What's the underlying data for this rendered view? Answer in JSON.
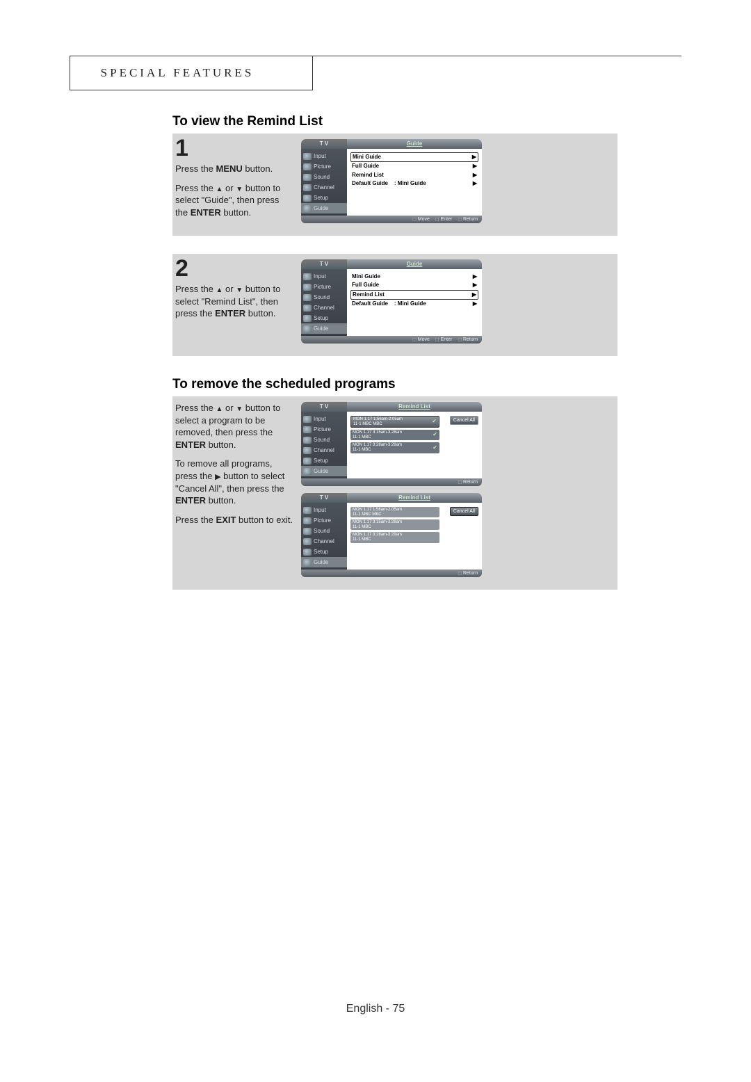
{
  "header": "SPECIAL FEATURES",
  "section1_title": "To view the Remind List",
  "step1": {
    "num": "1",
    "p1_a": "Press the ",
    "p1_b": "MENU",
    "p1_c": " button.",
    "p2_a": "Press the ",
    "p2_b": " or ",
    "p2_c": " button to select \"Guide\", then press the ",
    "p2_d": "ENTER",
    "p2_e": " button."
  },
  "step2": {
    "num": "2",
    "p1_a": "Press the ",
    "p1_b": " or ",
    "p1_c": " button to select \"Remind List\", then press the ",
    "p1_d": "ENTER",
    "p1_e": " button."
  },
  "section2_title": "To remove the scheduled programs",
  "step3": {
    "p1_a": "Press the ",
    "p1_b": " or ",
    "p1_c": " button to select a program to be removed, then press the ",
    "p1_d": "ENTER",
    "p1_e": " button.",
    "p2_a": "To remove all programs, press the ",
    "p2_b": " button to select \"Cancel All\", then press the ",
    "p2_c": "ENTER",
    "p2_d": " button.",
    "p3_a": "Press the ",
    "p3_b": "EXIT",
    "p3_c": " button to exit."
  },
  "osd": {
    "tv": "T V",
    "guide": "Guide",
    "remind_list": "Remind List",
    "nav": [
      "Input",
      "Picture",
      "Sound",
      "Channel",
      "Setup",
      "Guide"
    ],
    "items": [
      {
        "label": "Mini Guide",
        "arrow": "▶"
      },
      {
        "label": "Full Guide",
        "arrow": "▶"
      },
      {
        "label": "Remind List",
        "arrow": "▶"
      },
      {
        "label": "Default Guide",
        "value": ":    Mini Guide",
        "arrow": "▶"
      }
    ],
    "footer": {
      "move": "Move",
      "enter": "Enter",
      "ret": "Return"
    },
    "cancel_all": "Cancel All",
    "reminds": [
      {
        "line1": "MON 1.17 1:56am-2:05am",
        "line2": "11-1  MBC        MBC"
      },
      {
        "line1": "MON 1.17 3:15am-3:28am",
        "line2": "11-1  MBC"
      },
      {
        "line1": "MON 1.17 3:28am-3:29am",
        "line2": "11-1  MBC"
      }
    ]
  },
  "footer": "English - 75"
}
